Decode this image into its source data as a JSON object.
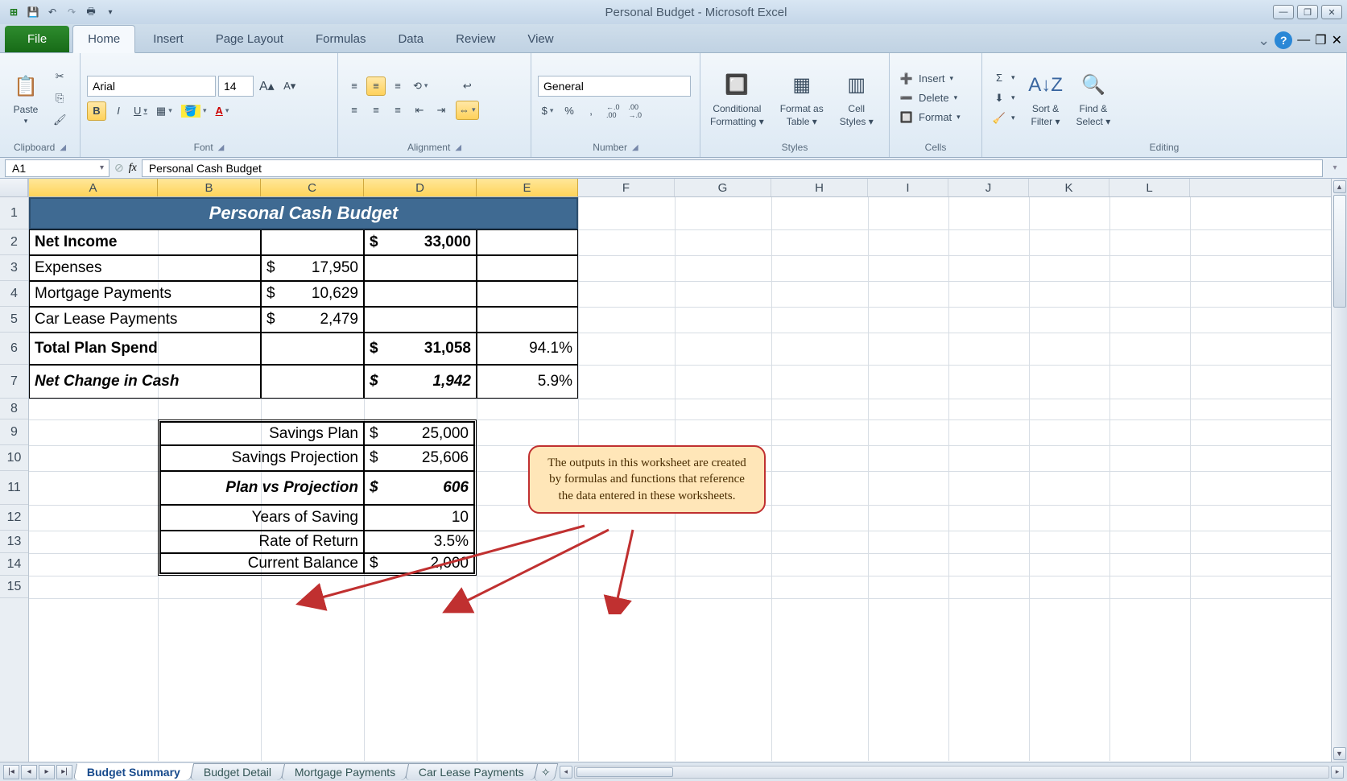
{
  "app_title": "Personal Budget - Microsoft Excel",
  "tabs": {
    "file": "File",
    "home": "Home",
    "insert": "Insert",
    "pagelayout": "Page Layout",
    "formulas": "Formulas",
    "data": "Data",
    "review": "Review",
    "view": "View"
  },
  "groups": {
    "clipboard": "Clipboard",
    "font": "Font",
    "alignment": "Alignment",
    "number": "Number",
    "styles": "Styles",
    "cells": "Cells",
    "editing": "Editing"
  },
  "clipboard": {
    "paste": "Paste"
  },
  "font": {
    "name": "Arial",
    "size": "14",
    "bold": "B",
    "italic": "I",
    "underline": "U"
  },
  "number": {
    "format": "General",
    "currency": "$",
    "percent": "%",
    "comma": ",",
    "inc": "←.0 .00",
    "dec": ".00 →.0"
  },
  "styles": {
    "cond1": "Conditional",
    "cond2": "Formatting",
    "fmt1": "Format as",
    "fmt2": "Table",
    "cell1": "Cell",
    "cell2": "Styles"
  },
  "cells": {
    "insert": "Insert",
    "delete": "Delete",
    "format": "Format"
  },
  "editing": {
    "sum": "Σ",
    "sort1": "Sort &",
    "sort2": "Filter",
    "find1": "Find &",
    "find2": "Select"
  },
  "namebox": "A1",
  "formula": "Personal Cash Budget",
  "columns": [
    "A",
    "B",
    "C",
    "D",
    "E",
    "F",
    "G",
    "H",
    "I",
    "J",
    "K",
    "L"
  ],
  "rows": [
    "1",
    "2",
    "3",
    "4",
    "5",
    "6",
    "7",
    "8",
    "9",
    "10",
    "11",
    "12",
    "13",
    "14",
    "15"
  ],
  "cells_data": {
    "title": "Personal Cash Budget",
    "r2a": "Net Income",
    "r2d": "33,000",
    "r3a": "Expenses",
    "r3c": "17,950",
    "r4a": "Mortgage Payments",
    "r4c": "10,629",
    "r5a": "Car Lease Payments",
    "r5c": "2,479",
    "r6a": "Total Plan Spend",
    "r6d": "31,058",
    "r6e": "94.1%",
    "r7a": "Net Change in Cash",
    "r7d": "1,942",
    "r7e": "5.9%",
    "r9bc": "Savings Plan",
    "r9d": "25,000",
    "r10bc": "Savings Projection",
    "r10d": "25,606",
    "r11bc": "Plan vs Projection",
    "r11d": "606",
    "r12bc": "Years of Saving",
    "r12d": "10",
    "r13bc": "Rate of Return",
    "r13d": "3.5%",
    "r14bc": "Current Balance",
    "r14d": "2,000"
  },
  "callout": "The outputs in this worksheet are created by formulas and functions that reference the data entered in these worksheets.",
  "sheets": {
    "s1": "Budget Summary",
    "s2": "Budget Detail",
    "s3": "Mortgage Payments",
    "s4": "Car Lease Payments"
  }
}
